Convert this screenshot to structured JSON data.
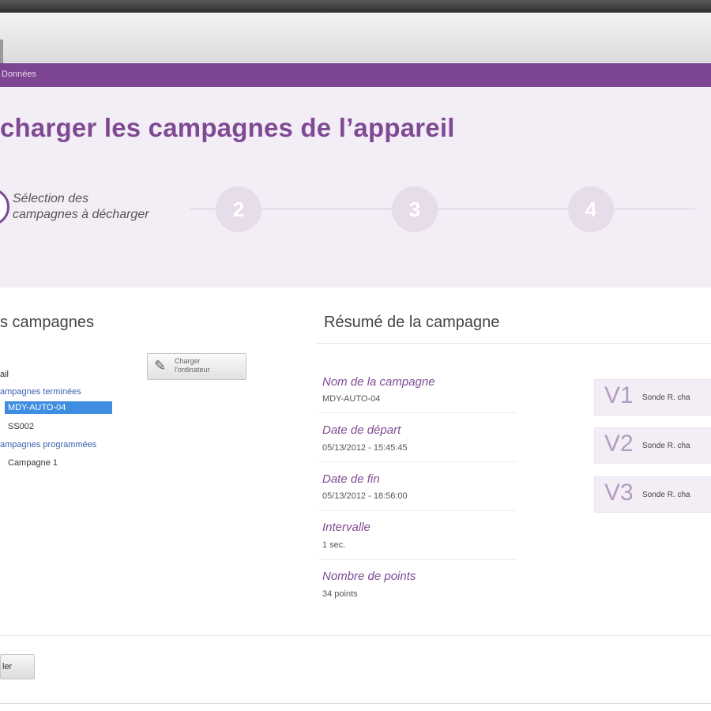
{
  "breadcrumb": {
    "text": "Données"
  },
  "page": {
    "title": "charger les campagnes de l’appareil"
  },
  "stepper": {
    "step1_label_line1": "Sélection des",
    "step1_label_line2": "campagnes à décharger",
    "steps": [
      "2",
      "3",
      "4"
    ]
  },
  "left_panel": {
    "title": "s campagnes",
    "tree": {
      "root": "ail",
      "group_recorded": "ampagnes terminées",
      "item_selected": "MDY-AUTO-04",
      "item_2": "SS002",
      "group_scheduled": "ampagnes programmées",
      "item_3": "Campagne 1"
    },
    "import_button": {
      "line1": "Charger",
      "line2": "l’ordinateur"
    }
  },
  "summary": {
    "title": "Résumé de la campagne",
    "fields": [
      {
        "label": "Nom de la campagne",
        "value": "MDY-AUTO-04"
      },
      {
        "label": "Date de départ",
        "value": "05/13/2012 - 15:45:45"
      },
      {
        "label": "Date de fin",
        "value": "05/13/2012 - 18:56:00"
      },
      {
        "label": "Intervalle",
        "value": "1 sec."
      },
      {
        "label": "Nombre de points",
        "value": "34 points"
      }
    ],
    "channels": [
      {
        "name": "V1",
        "desc": "Sonde R. cha"
      },
      {
        "name": "V2",
        "desc": "Sonde R. cha"
      },
      {
        "name": "V3",
        "desc": "Sonde R. cha"
      }
    ]
  },
  "footer": {
    "button_label": "ler"
  },
  "colors": {
    "accent": "#7f4a93",
    "bar": "#7d4592",
    "panel": "#f3eef6",
    "selection": "#3f8de0"
  }
}
